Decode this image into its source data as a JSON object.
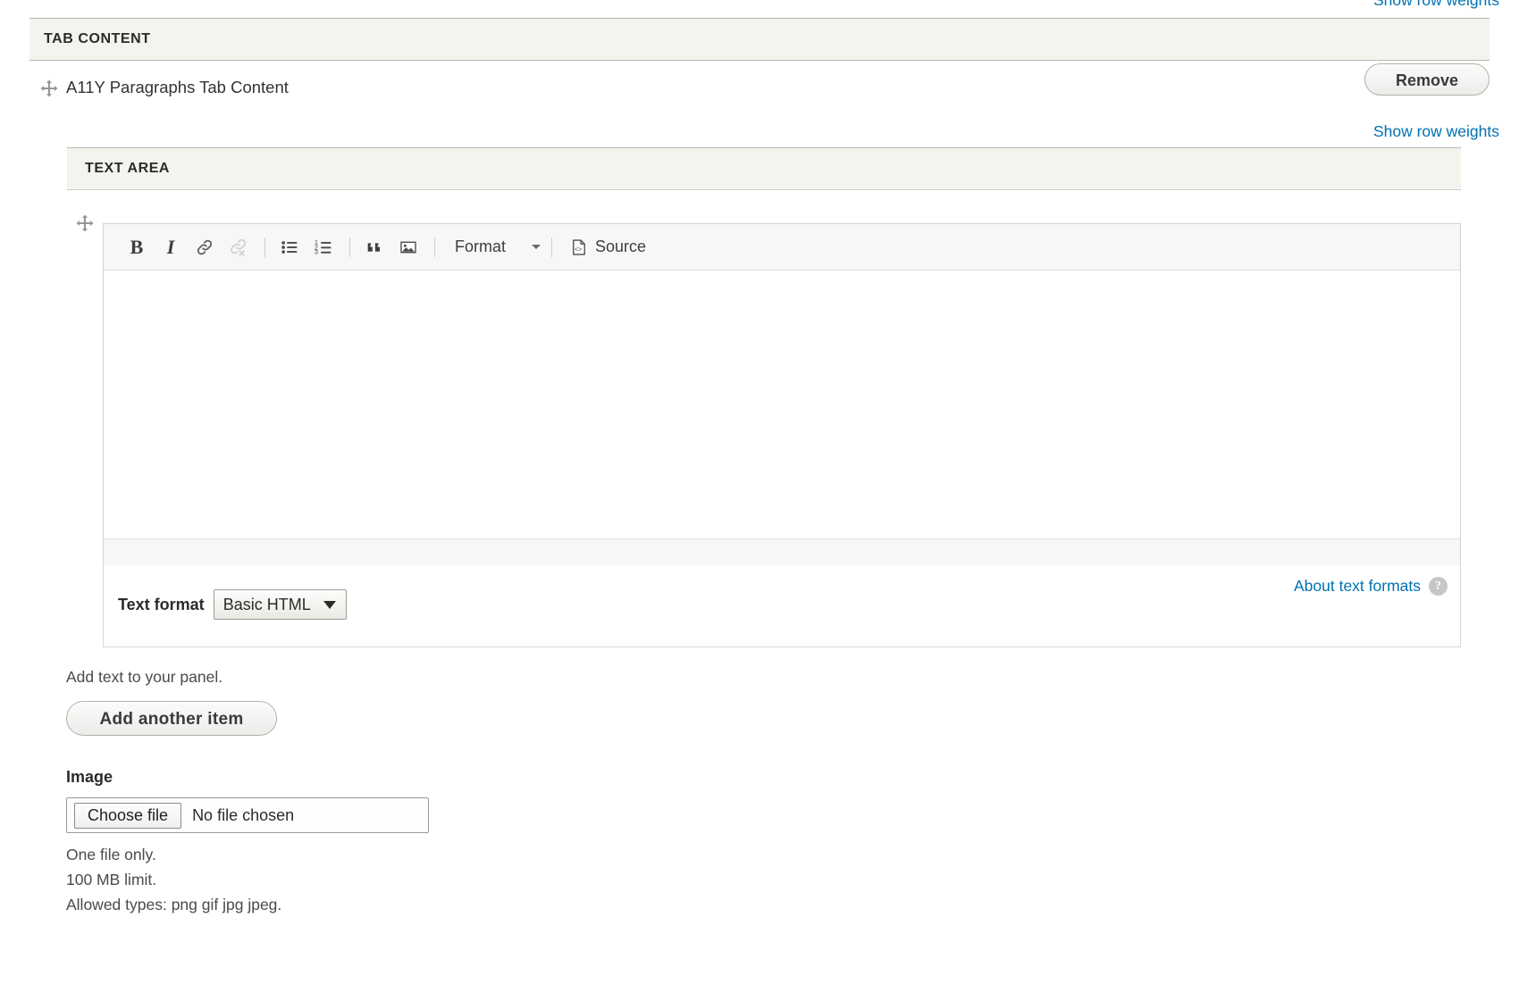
{
  "top": {
    "show_row_weights": "Show row weights"
  },
  "tab_content": {
    "header": "TAB CONTENT",
    "paragraph_label": "A11Y Paragraphs Tab Content",
    "remove_label": "Remove",
    "show_row_weights": "Show row weights",
    "drag_icon": "move-arrows-icon"
  },
  "text_area": {
    "header": "TEXT AREA",
    "drag_icon": "move-arrows-icon"
  },
  "editor": {
    "toolbar": [
      {
        "name": "bold-button",
        "icon": "bold-icon",
        "label": "B",
        "disabled": false
      },
      {
        "name": "italic-button",
        "icon": "italic-icon",
        "label": "I",
        "disabled": false
      },
      {
        "name": "link-button",
        "icon": "link-icon",
        "label": "",
        "disabled": false
      },
      {
        "name": "unlink-button",
        "icon": "unlink-icon",
        "label": "",
        "disabled": true
      },
      {
        "name": "bulleted-list-button",
        "icon": "bulleted-list-icon",
        "label": "",
        "disabled": false
      },
      {
        "name": "numbered-list-button",
        "icon": "numbered-list-icon",
        "label": "",
        "disabled": false
      },
      {
        "name": "blockquote-button",
        "icon": "blockquote-icon",
        "label": "",
        "disabled": false
      },
      {
        "name": "image-button",
        "icon": "image-icon",
        "label": "",
        "disabled": false
      }
    ],
    "format_combo_label": "Format",
    "source_label": "Source",
    "source_icon": "source-code-icon",
    "body_value": ""
  },
  "text_format": {
    "label": "Text format",
    "selected": "Basic HTML",
    "options": [
      "Basic HTML"
    ],
    "about_link": "About text formats",
    "help_icon": "question-mark-icon",
    "help_glyph": "?"
  },
  "bottom": {
    "description": "Add text to your panel.",
    "add_another_label": "Add another item",
    "image_label": "Image",
    "file": {
      "button_label": "Choose file",
      "status": "No file chosen"
    },
    "hints": [
      "One file only.",
      "100 MB limit.",
      "Allowed types: png gif jpg jpeg."
    ]
  },
  "colors": {
    "link": "#0071b3",
    "header_bg": "#f3f4ee",
    "header_border": "#b8b8ad",
    "toolbar_bg": "#f7f7f7",
    "text": "#333333"
  }
}
